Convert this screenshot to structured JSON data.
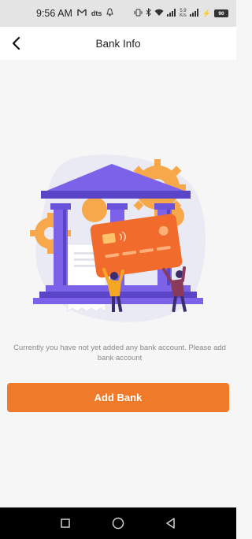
{
  "status_bar": {
    "time": "9:56 AM",
    "left_icons": [
      "gmail-icon",
      "dts-icon",
      "bell-icon"
    ],
    "dts_label": "dts",
    "right_icons": [
      "vibrate-icon",
      "bluetooth-icon",
      "wifi-icon",
      "signal-icon",
      "battery-icon"
    ],
    "net_speed_value": "5.9",
    "net_speed_unit": "K/s",
    "battery_level": "90"
  },
  "header": {
    "back_icon": "chevron-left-icon",
    "title": "Bank Info"
  },
  "illustration": {
    "description_icon": "bank-card-illustration",
    "colors": {
      "bank": "#7b62e8",
      "bank_dark": "#5a44c8",
      "gear": "#f6a84a",
      "card": "#f06b2c",
      "background_blob": "#e9eaf3"
    }
  },
  "empty_state": {
    "message": "Currently you have not yet added any bank account. Please add bank account"
  },
  "actions": {
    "add_bank_label": "Add Bank",
    "accent_color": "#ef7a29"
  },
  "nav_bar": {
    "recent_icon": "square-icon",
    "home_icon": "circle-icon",
    "back_icon": "triangle-back-icon"
  }
}
